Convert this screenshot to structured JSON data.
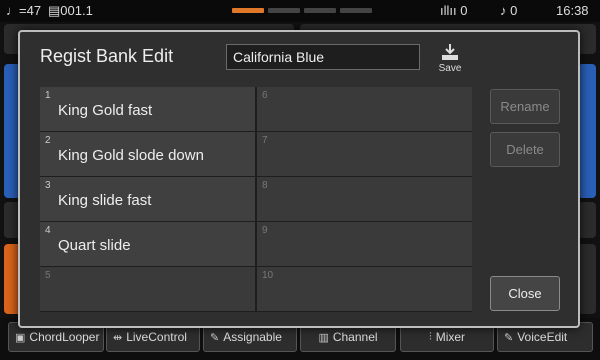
{
  "status": {
    "tempo": "♩=47",
    "bar": "001.1",
    "mic_value": "0",
    "dj_value": "0",
    "time": "16:38"
  },
  "dialog": {
    "title": "Regist Bank Edit",
    "name_value": "California Blue",
    "save_label": "Save",
    "slots": [
      {
        "num": "1",
        "name": "King Gold fast"
      },
      {
        "num": "2",
        "name": "King Gold slode down"
      },
      {
        "num": "3",
        "name": "King slide fast"
      },
      {
        "num": "4",
        "name": "Quart slide"
      },
      {
        "num": "5",
        "name": ""
      },
      {
        "num": "6",
        "name": ""
      },
      {
        "num": "7",
        "name": ""
      },
      {
        "num": "8",
        "name": ""
      },
      {
        "num": "9",
        "name": ""
      },
      {
        "num": "10",
        "name": ""
      }
    ],
    "rename_label": "Rename",
    "delete_label": "Delete",
    "close_label": "Close"
  },
  "bottom_bar": [
    {
      "label": "ChordLooper",
      "icon": "chord-looper-icon"
    },
    {
      "label": "LiveControl",
      "icon": "live-control-icon"
    },
    {
      "label": "Assignable",
      "icon": "assignable-icon"
    },
    {
      "label": "Channel",
      "icon": "channel-icon"
    },
    {
      "label": "Mixer",
      "icon": "mixer-icon"
    },
    {
      "label": "VoiceEdit",
      "icon": "voice-edit-icon"
    }
  ],
  "colors": {
    "accent_orange": "#e0782a",
    "panel_blue": "#2a5fb8"
  }
}
